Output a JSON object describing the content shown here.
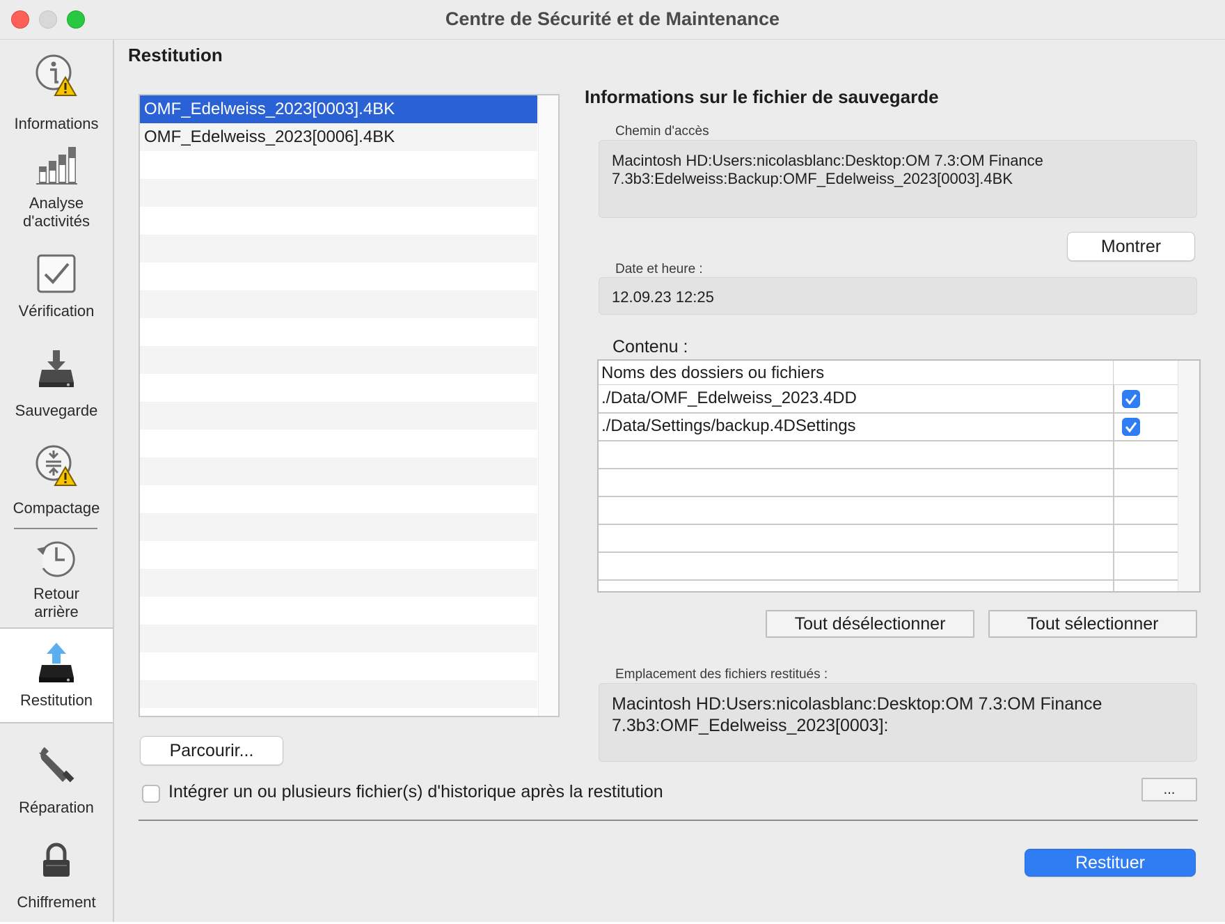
{
  "window": {
    "title": "Centre de Sécurité et de Maintenance"
  },
  "sidebar": {
    "items": [
      {
        "label": "Informations",
        "icon": "info-warning-icon"
      },
      {
        "label": "Analyse d'activités",
        "icon": "bar-chart-icon"
      },
      {
        "label": "Vérification",
        "icon": "checkbox-check-icon"
      },
      {
        "label": "Sauvegarde",
        "icon": "backup-drive-icon"
      },
      {
        "label": "Compactage",
        "icon": "compact-warning-icon"
      },
      {
        "label": "Retour arrière",
        "icon": "rollback-clock-icon"
      },
      {
        "label": "Restitution",
        "icon": "restore-drive-icon",
        "selected": true
      },
      {
        "label": "Réparation",
        "icon": "wrench-icon"
      },
      {
        "label": "Chiffrement",
        "icon": "lock-icon"
      }
    ]
  },
  "main": {
    "section_title": "Restitution",
    "backups": [
      {
        "name": "OMF_Edelweiss_2023[0003].4BK",
        "selected": true
      },
      {
        "name": "OMF_Edelweiss_2023[0006].4BK",
        "selected": false
      }
    ],
    "browse_label": "Parcourir...",
    "integrate_checkbox": {
      "label": "Intégrer un ou plusieurs fichier(s) d'historique après la restitution",
      "checked": false
    },
    "more_button_label": "...",
    "restore_button_label": "Restituer"
  },
  "info": {
    "title": "Informations sur le fichier de sauvegarde",
    "path_label": "Chemin d'accès",
    "path_line1": "Macintosh HD:Users:nicolasblanc:Desktop:OM 7.3:OM Finance",
    "path_line2": "7.3b3:Edelweiss:Backup:OMF_Edelweiss_2023[0003].4BK",
    "show_button_label": "Montrer",
    "date_label": "Date et heure :",
    "date_value": "12.09.23 12:25",
    "content_label": "Contenu :",
    "content_table": {
      "header": "Noms des dossiers ou fichiers",
      "rows": [
        {
          "name": "./Data/OMF_Edelweiss_2023.4DD",
          "checked": true
        },
        {
          "name": "./Data/Settings/backup.4DSettings",
          "checked": true
        }
      ]
    },
    "deselect_all_label": "Tout désélectionner",
    "select_all_label": "Tout sélectionner",
    "dest_label": "Emplacement des fichiers restitués :",
    "dest_line1": "Macintosh HD:Users:nicolasblanc:Desktop:OM 7.3:OM Finance",
    "dest_line2": "7.3b3:OMF_Edelweiss_2023[0003]:"
  },
  "colors": {
    "accent": "#2f7cf3",
    "selection": "#2a62d6",
    "warning": "#f5c400"
  }
}
